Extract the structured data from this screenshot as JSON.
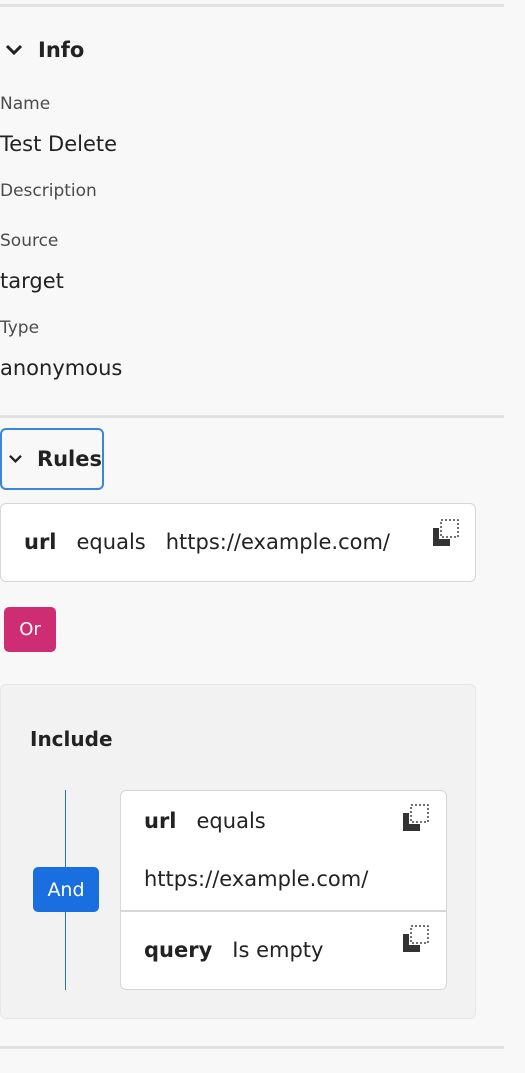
{
  "info": {
    "heading": "Info",
    "fields": [
      {
        "label": "Name",
        "value": "Test Delete"
      },
      {
        "label": "Description",
        "value": ""
      },
      {
        "label": "Source",
        "value": "target"
      },
      {
        "label": "Type",
        "value": "anonymous"
      }
    ]
  },
  "rules": {
    "heading": "Rules",
    "rule1": {
      "field": "url",
      "operator": "equals",
      "value": "https://example.com/"
    },
    "or_label": "Or",
    "group": {
      "title": "Include",
      "and_label": "And",
      "conditions": [
        {
          "field": "url",
          "operator": "equals",
          "value": "https://example.com/"
        },
        {
          "field": "query",
          "operator": "Is empty",
          "value": ""
        }
      ]
    }
  },
  "colors": {
    "or_button": "#cf2d73",
    "and_button": "#1a6fe0",
    "focus_ring": "#3b86d8"
  },
  "icons": [
    "chevron-down-icon",
    "copy-icon"
  ]
}
